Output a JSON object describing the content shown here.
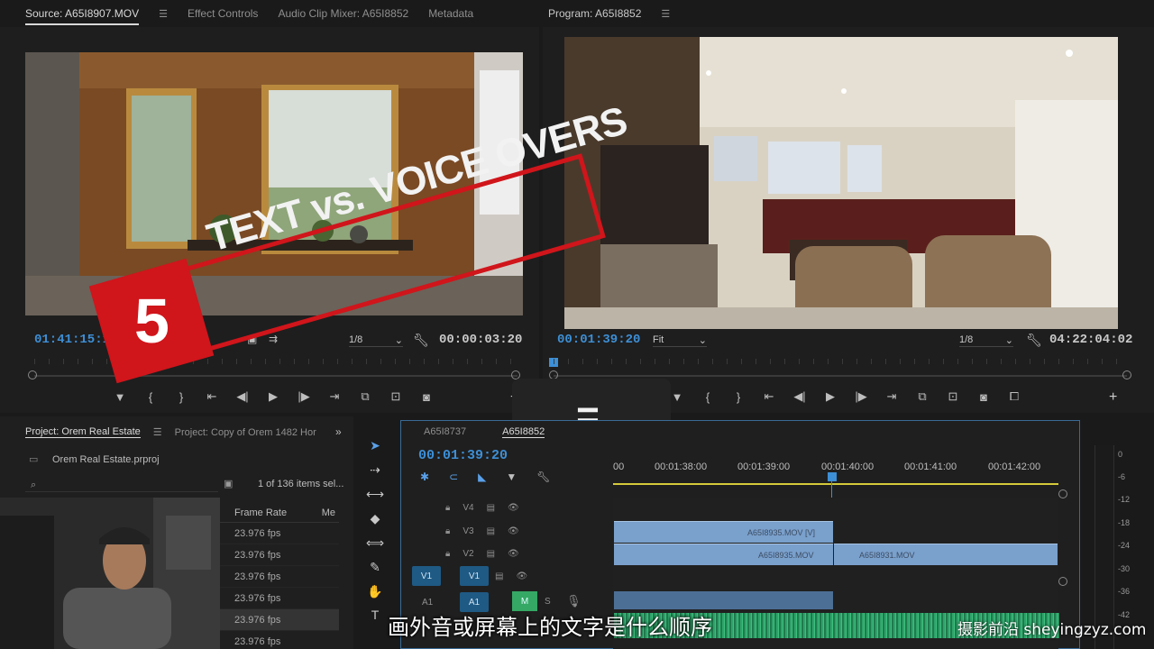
{
  "source_panel": {
    "tabs": [
      {
        "label": "Source: A65I8907.MOV"
      },
      {
        "label": "Effect Controls"
      },
      {
        "label": "Audio Clip Mixer: A65I8852"
      },
      {
        "label": "Metadata"
      }
    ],
    "timecode_left": "01:41:15:18",
    "resolution": "1/8",
    "duration": "00:00:03:20"
  },
  "program_panel": {
    "tab": "Program: A65I8852",
    "timecode_left": "00:01:39:20",
    "fit": "Fit",
    "resolution": "1/8",
    "duration": "04:22:04:02"
  },
  "overlay_graphic": {
    "number": "5",
    "title": "TEXT vs. VOICE OVERS",
    "accent": "#d0151b"
  },
  "center_popup": {
    "glyph": "="
  },
  "project_panel": {
    "tabs": [
      {
        "label": "Project: Orem Real Estate"
      },
      {
        "label": "Project: Copy of Orem 1482 Hor"
      }
    ],
    "file": "Orem Real Estate.prproj",
    "items_count": "1 of 136 items sel...",
    "columns": {
      "frame_rate": "Frame Rate",
      "media": "Me"
    },
    "rows": [
      "23.976 fps",
      "23.976 fps",
      "23.976 fps",
      "23.976 fps",
      "23.976 fps",
      "23.976 fps"
    ]
  },
  "timeline": {
    "tabs": [
      {
        "label": "A65I8737"
      },
      {
        "label": "A65I8852"
      }
    ],
    "timecode": "00:01:39:20",
    "ruler": [
      "00",
      "00:01:38:00",
      "00:01:39:00",
      "00:01:40:00",
      "00:01:41:00",
      "00:01:42:00"
    ],
    "tracks": [
      {
        "name": "V4",
        "target": ""
      },
      {
        "name": "V3",
        "target": ""
      },
      {
        "name": "V2",
        "target": ""
      },
      {
        "name": "V1",
        "target": "V1"
      },
      {
        "name": "A1",
        "target": "A1"
      }
    ],
    "clips": [
      {
        "label": "A65I8935.MOV [V]"
      },
      {
        "label": "A65I8935.MOV"
      },
      {
        "label": "A65I8931.MOV"
      }
    ],
    "mute_label": "M",
    "solo_label": "S"
  },
  "audio_meter": {
    "labels": [
      "0",
      "-6",
      "-12",
      "-18",
      "-24",
      "-30",
      "-36",
      "-42"
    ]
  },
  "subtitle": "画外音或屏幕上的文字是什么顺序",
  "watermark": "摄影前沿 sheyingzyz.com"
}
